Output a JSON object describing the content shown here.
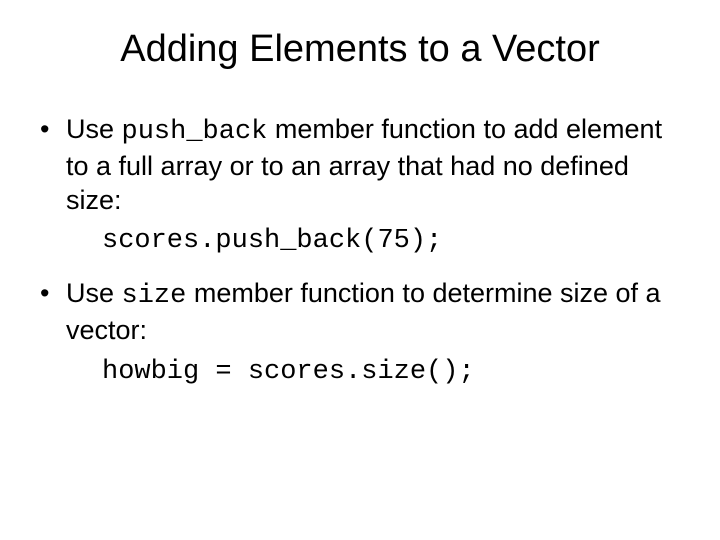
{
  "title": "Adding Elements to a Vector",
  "bullets": {
    "b1": {
      "pre": "Use ",
      "code": "push_back",
      "post": " member function to add element to a full array or to an array that had no defined size:"
    },
    "code1": "scores.push_back(75);",
    "b2": {
      "pre": "Use ",
      "code": "size",
      "post": " member function to determine size of a vector:"
    },
    "code2": "howbig = scores.size();"
  }
}
